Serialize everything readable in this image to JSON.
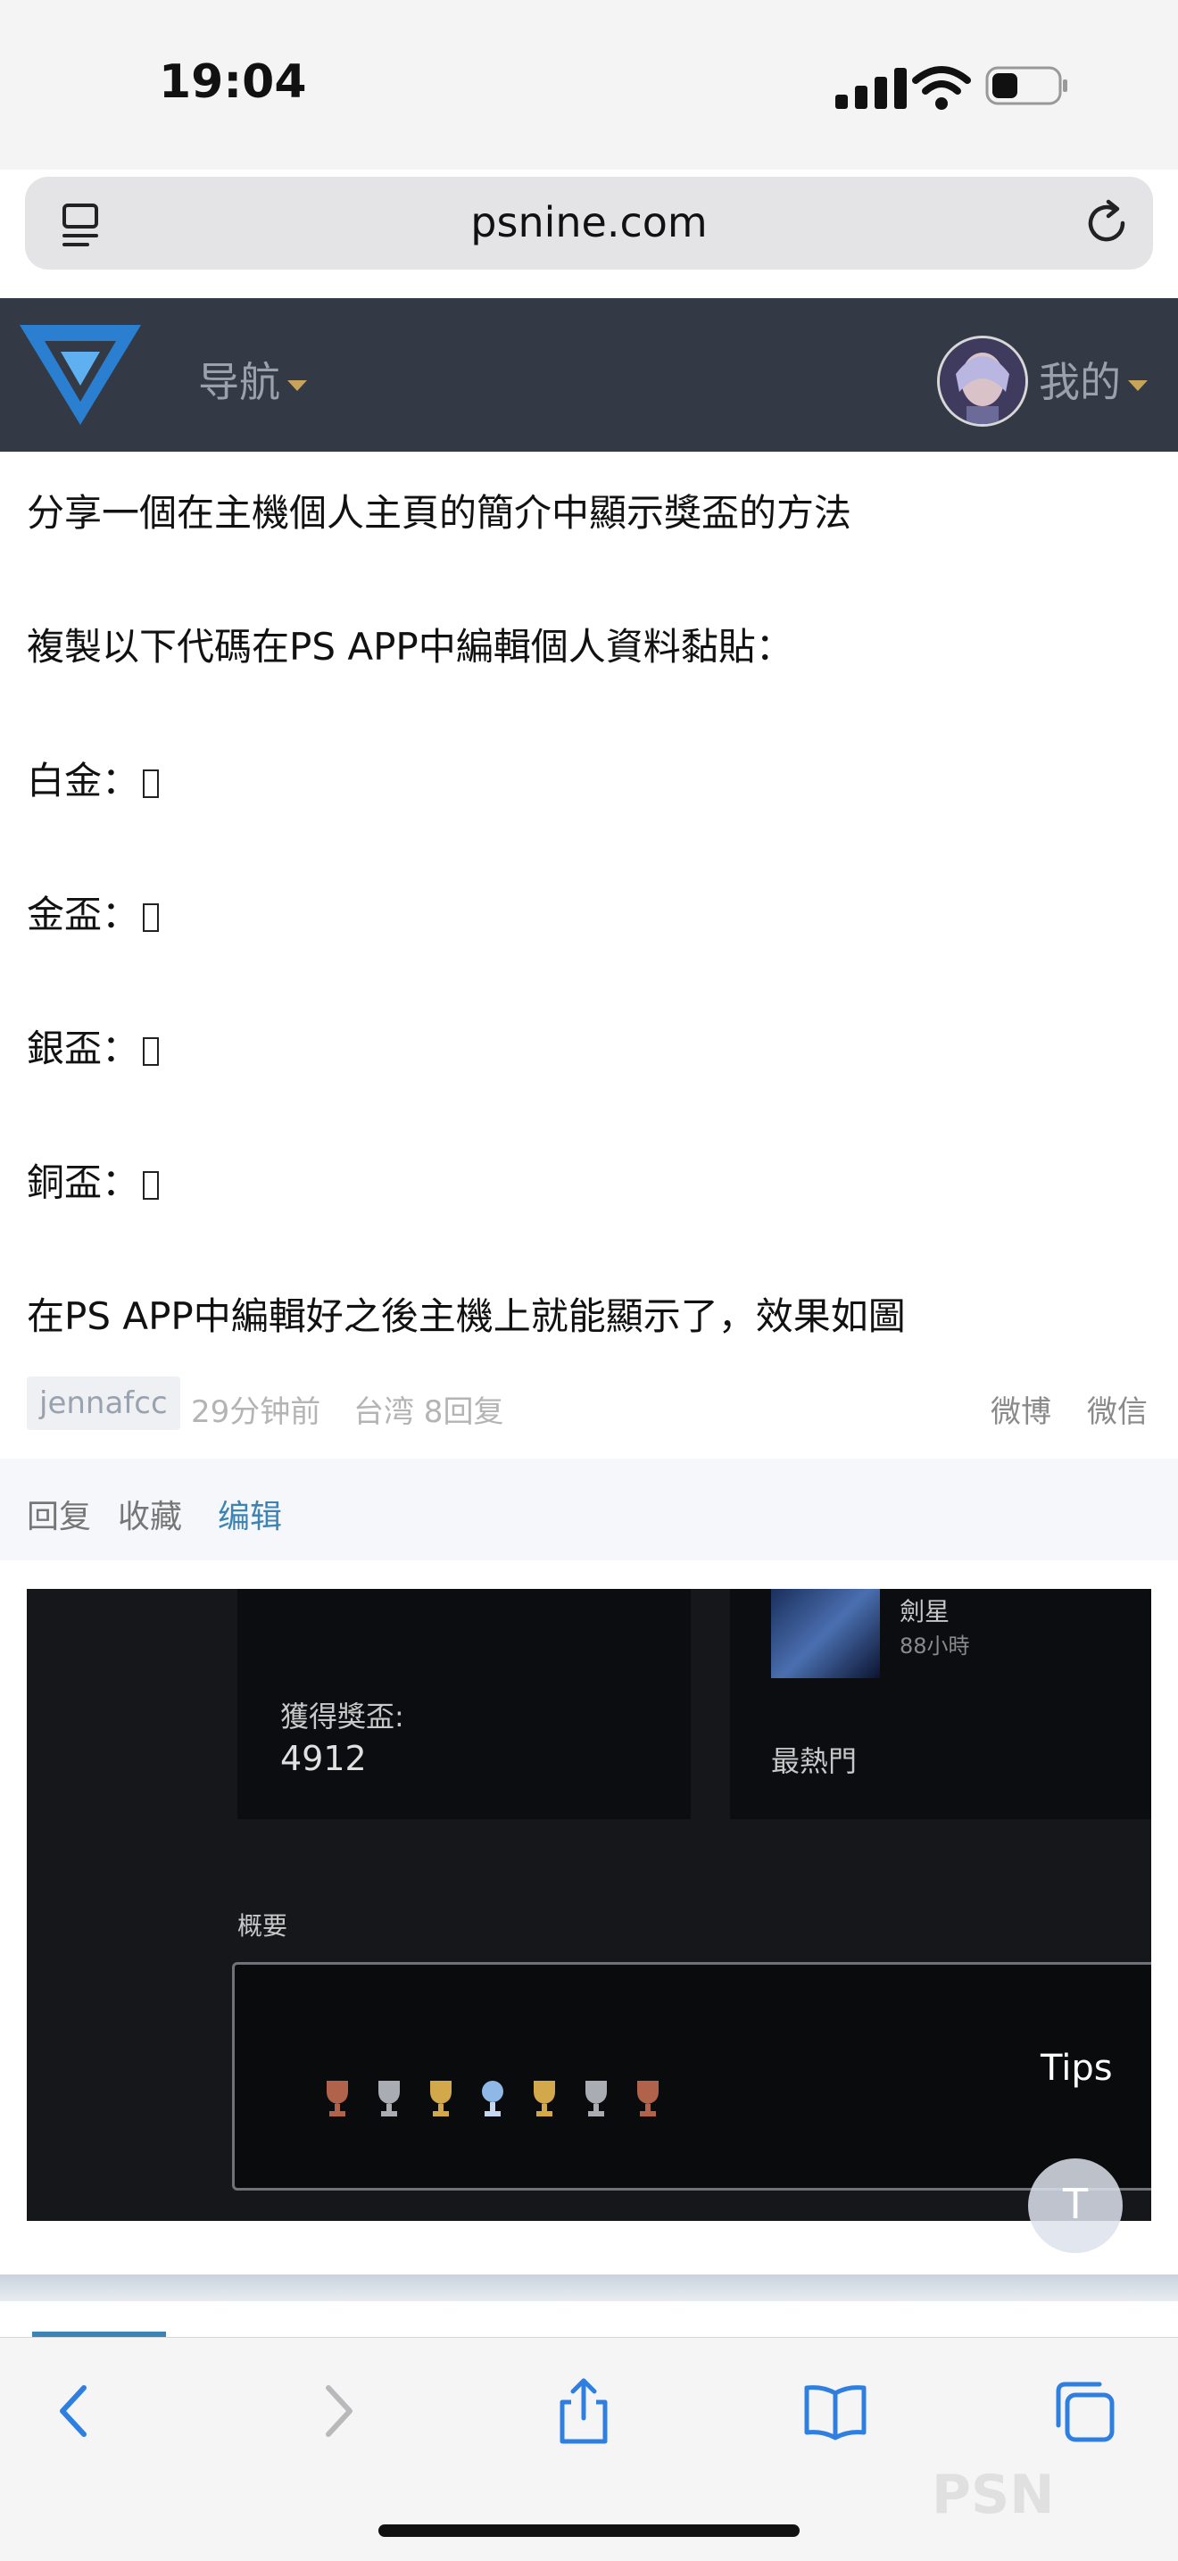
{
  "status_bar": {
    "time": "19:04"
  },
  "browser": {
    "url": "psnine.com"
  },
  "nav": {
    "menu_label": "导航",
    "mine_label": "我的"
  },
  "post": {
    "line1": "分享一個在主機個人主頁的簡介中顯示獎盃的方法",
    "line2": "複製以下代碼在PS APP中編輯個人資料黏貼：",
    "platinum": "白金：",
    "gold": "金盃：",
    "silver": "銀盃：",
    "bronze": "銅盃：",
    "line7": "在PS APP中編輯好之後主機上就能顯示了，效果如圖"
  },
  "meta": {
    "author": "jennafcc",
    "time": "29分钟前",
    "location_replies": "台湾 8回复",
    "weibo": "微博",
    "wechat": "微信"
  },
  "actions": {
    "reply": "回复",
    "favorite": "收藏",
    "edit": "编辑"
  },
  "screenshot": {
    "trophies_label": "獲得獎盃:",
    "trophies_count": "4912",
    "game_title": "劍星",
    "game_hours": "88小時",
    "most_popular": "最熱門",
    "overview": "概要",
    "tips": "Tips"
  },
  "float_button": {
    "label": "T"
  },
  "watermark": "PSN",
  "colors": {
    "nav_bg": "#333a45",
    "accent": "#3b84b4",
    "caret": "#c8a35a"
  }
}
